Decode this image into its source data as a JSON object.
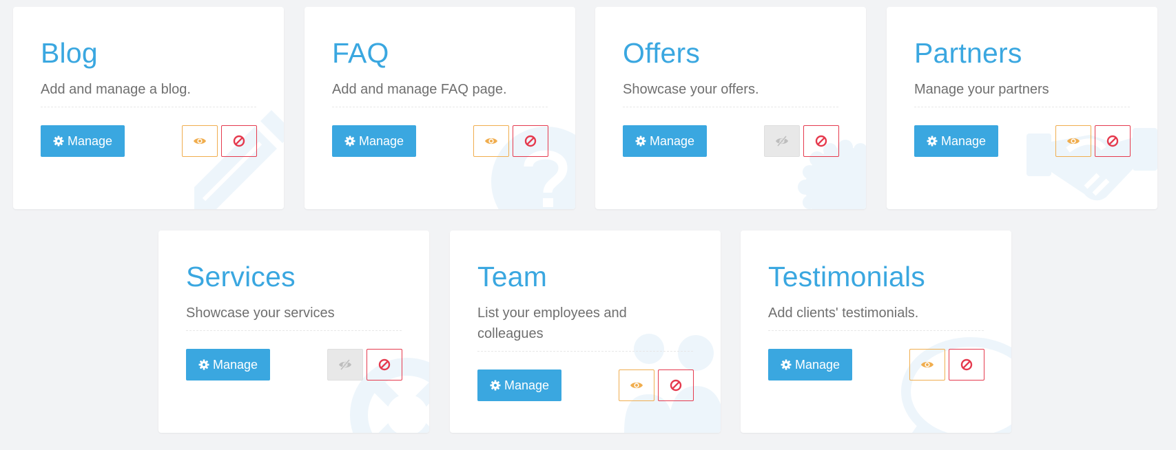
{
  "colors": {
    "accent": "#3aa7e0",
    "warning": "#f0ad4e",
    "danger": "#e5394d",
    "muted": "#bdbdbd",
    "art": "#edf5fb"
  },
  "modules": [
    {
      "title": "Blog",
      "description": "Add and manage a blog.",
      "manage_label": "Manage",
      "visible": true,
      "art_icon": "pencil-icon"
    },
    {
      "title": "FAQ",
      "description": "Add and manage FAQ page.",
      "manage_label": "Manage",
      "visible": true,
      "art_icon": "question-icon"
    },
    {
      "title": "Offers",
      "description": "Showcase your offers.",
      "manage_label": "Manage",
      "visible": false,
      "art_icon": "badge-icon"
    },
    {
      "title": "Partners",
      "description": "Manage your partners",
      "manage_label": "Manage",
      "visible": true,
      "art_icon": "handshake-icon"
    },
    {
      "title": "Services",
      "description": "Showcase your services",
      "manage_label": "Manage",
      "visible": false,
      "art_icon": "lifebuoy-icon"
    },
    {
      "title": "Team",
      "description": "List your employees and colleagues",
      "manage_label": "Manage",
      "visible": true,
      "art_icon": "users-icon"
    },
    {
      "title": "Testimonials",
      "description": "Add clients' testimonials.",
      "manage_label": "Manage",
      "visible": true,
      "art_icon": "speech-bubble-icon"
    }
  ]
}
